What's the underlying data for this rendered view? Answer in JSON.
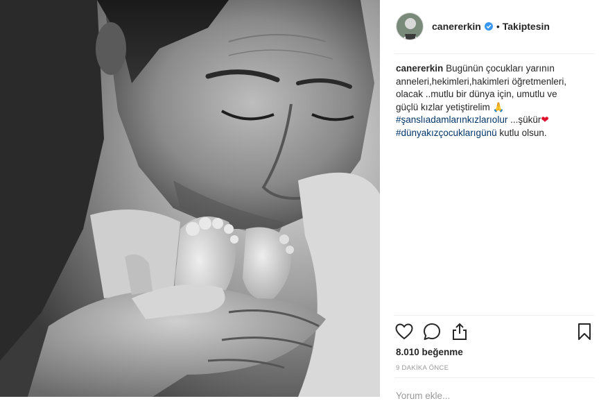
{
  "post": {
    "username": "canererkin",
    "separator": "•",
    "follow_status": "Takiptesin",
    "caption": {
      "username": "canererkin",
      "text": "Bugünün çocukları yarının anneleri,hekimleri,hakimleri öğretmenleri, olacak ..mutlu bir dünya için, umutlu ve güçlü kızlar yetiştirelim",
      "pray_emoji": "🙏",
      "hashtag1": "#şanslıadamlarınkızlarıolur",
      "mid_text": " ...şükür",
      "heart_emoji": "❤",
      "hashtag2": "#dünyakızçocuklarıgünü",
      "end_text": " kutlu olsun."
    },
    "likes": "8.010 beğenme",
    "timestamp": "9 DAKİKA ÖNCE",
    "comment_placeholder": "Yorum ekle..."
  },
  "icons": {
    "verified": "verified-badge-icon",
    "like": "heart-outline-icon",
    "comment": "comment-bubble-icon",
    "share": "share-upload-icon",
    "save": "bookmark-icon"
  },
  "colors": {
    "verified": "#3897f0",
    "hashtag": "#003569",
    "heart": "#e0112b",
    "muted": "#999999"
  },
  "image": {
    "alt": "black and white photo of a man kissing a newborn baby's feet"
  }
}
